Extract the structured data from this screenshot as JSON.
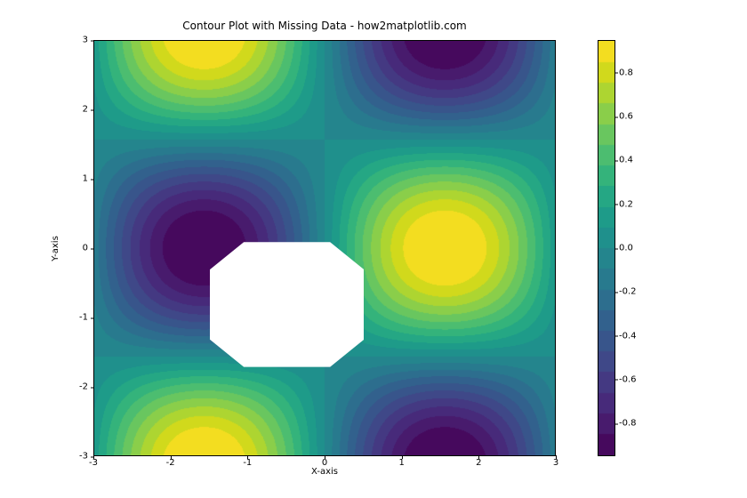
{
  "chart_data": {
    "type": "contour",
    "title": "Contour Plot with Missing Data - how2matplotlib.com",
    "xlabel": "X-axis",
    "ylabel": "Y-axis",
    "xlim": [
      -3,
      3
    ],
    "ylim": [
      -3,
      3
    ],
    "xticks": [
      -3,
      -2,
      -1,
      0,
      1,
      2,
      3
    ],
    "yticks": [
      -3,
      -2,
      -1,
      0,
      1,
      2,
      3
    ],
    "function": "sin(x) * cos(y)",
    "missing_region": {
      "x": [
        -1.5,
        0.5
      ],
      "y": [
        -1.7,
        0.1
      ],
      "shape": "octagon"
    },
    "colormap": "viridis",
    "levels": 20,
    "value_range": [
      -0.95,
      0.95
    ],
    "colorbar_ticks": [
      -0.8,
      -0.6,
      -0.4,
      -0.2,
      0.0,
      0.2,
      0.4,
      0.6,
      0.8
    ],
    "colorbar_tick_labels": [
      "-0.8",
      "-0.6",
      "-0.4",
      "-0.2",
      "0.0",
      "0.2",
      "0.4",
      "0.6",
      "0.8"
    ],
    "peaks": [
      {
        "x": -1.57,
        "y": 3.0,
        "value": 0.99
      },
      {
        "x": 1.57,
        "y": 0.0,
        "value": 1.0
      },
      {
        "x": -1.57,
        "y": -3.0,
        "value": 0.99
      }
    ],
    "troughs": [
      {
        "x": 1.57,
        "y": 3.0,
        "value": -0.99
      },
      {
        "x": -1.57,
        "y": 0.0,
        "value": -1.0
      },
      {
        "x": 1.57,
        "y": -3.0,
        "value": -0.99
      }
    ]
  },
  "title": "Contour Plot with Missing Data - how2matplotlib.com",
  "xlabel": "X-axis",
  "ylabel": "Y-axis"
}
